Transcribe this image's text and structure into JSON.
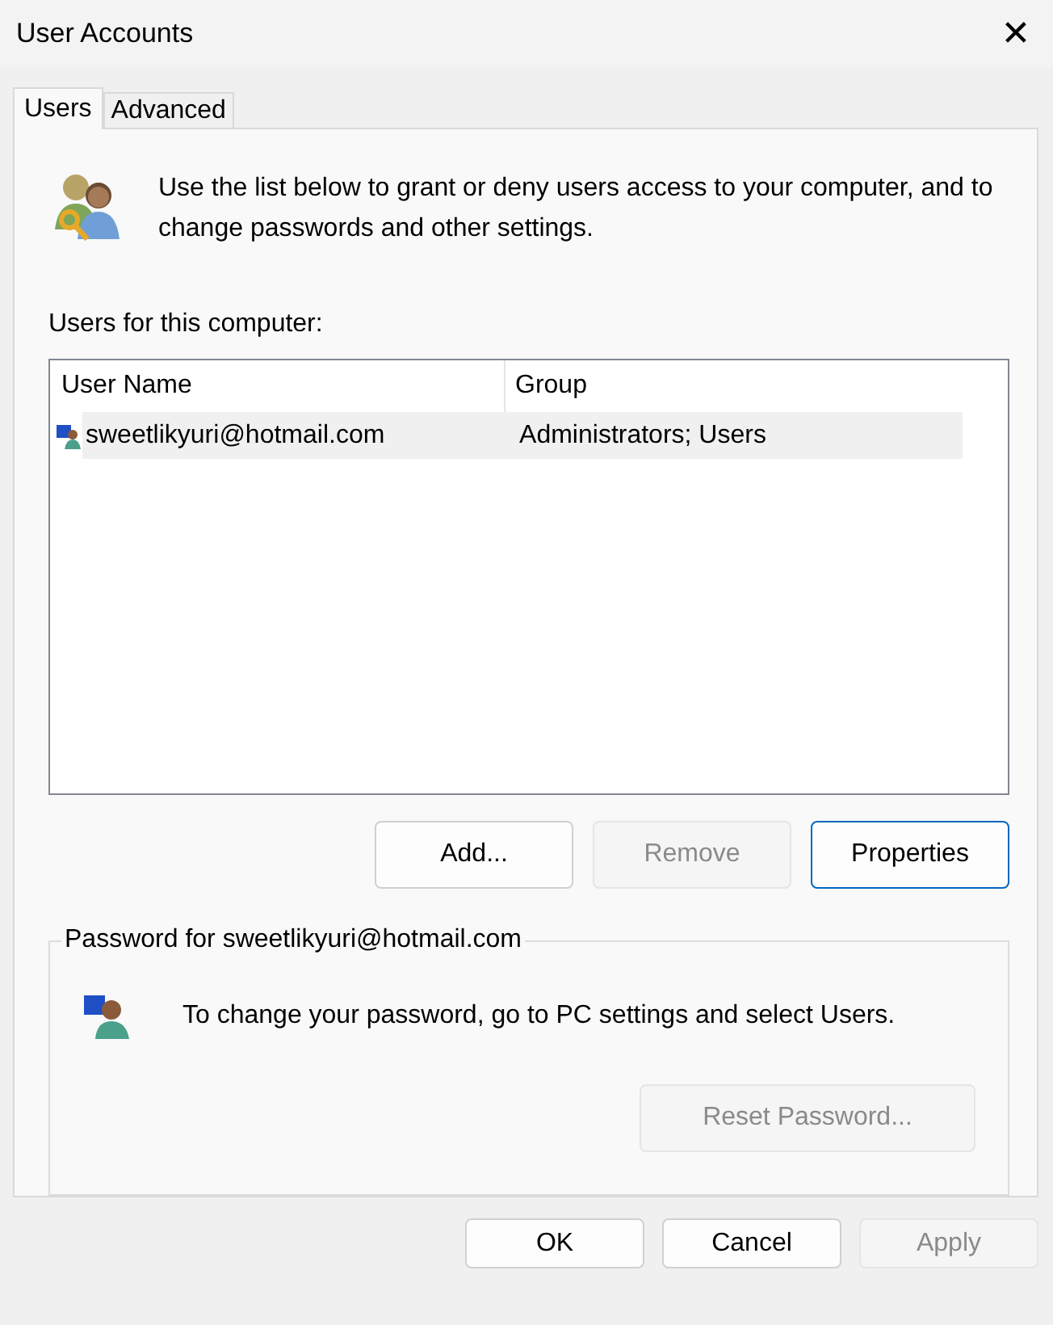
{
  "window": {
    "title": "User Accounts",
    "close": "✕"
  },
  "tabs": [
    {
      "label": "Users",
      "selected": true
    },
    {
      "label": "Advanced",
      "selected": false
    }
  ],
  "intro": "Use the list below to grant or deny users access to your computer, and to change passwords and other settings.",
  "users_label": "Users for this computer:",
  "table": {
    "columns": [
      "User Name",
      "Group"
    ],
    "rows": [
      {
        "user_name": "sweetlikyuri@hotmail.com",
        "group": "Administrators; Users",
        "selected": true
      }
    ]
  },
  "list_buttons": [
    {
      "label": "Add...",
      "disabled": false,
      "default": false
    },
    {
      "label": "Remove",
      "disabled": true,
      "default": false
    },
    {
      "label": "Properties",
      "disabled": false,
      "default": true
    }
  ],
  "password_group": {
    "title": "Password for sweetlikyuri@hotmail.com",
    "message": "To change your password, go to PC settings and select Users.",
    "button": {
      "label": "Reset Password...",
      "disabled": true
    }
  },
  "dialog_buttons": [
    {
      "label": "OK",
      "disabled": false
    },
    {
      "label": "Cancel",
      "disabled": false
    },
    {
      "label": "Apply",
      "disabled": true
    }
  ]
}
